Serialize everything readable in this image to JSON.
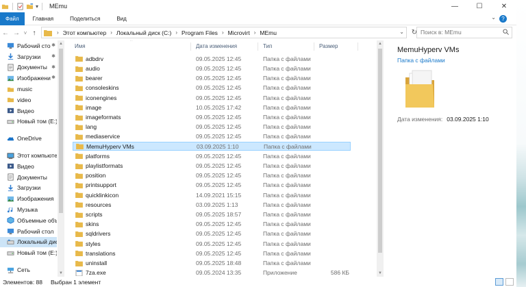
{
  "window": {
    "title": "MEmu",
    "controls": {
      "minimize": "—",
      "maximize": "☐",
      "close": "✕"
    }
  },
  "ribbon": {
    "tabs": [
      "Файл",
      "Главная",
      "Поделиться",
      "Вид"
    ]
  },
  "nav": {
    "back": "←",
    "forward": "→",
    "recent": "˅",
    "up": "↑"
  },
  "address": {
    "crumbs": [
      "Этот компьютер",
      "Локальный диск (C:)",
      "Program Files",
      "Microvirt",
      "MEmu"
    ]
  },
  "search": {
    "placeholder": "Поиск в: MEmu"
  },
  "sidebar": {
    "items": [
      {
        "label": "Рабочий сто",
        "icon": "desktop-icon",
        "pinned": true
      },
      {
        "label": "Загрузки",
        "icon": "downloads-icon",
        "pinned": true
      },
      {
        "label": "Документы",
        "icon": "documents-icon",
        "pinned": true
      },
      {
        "label": "Изображени",
        "icon": "pictures-icon",
        "pinned": true
      },
      {
        "label": "music",
        "icon": "folder-icon"
      },
      {
        "label": "video",
        "icon": "folder-icon"
      },
      {
        "label": "Видео",
        "icon": "videos-icon"
      },
      {
        "label": "Новый том (E:)",
        "icon": "drive-icon"
      },
      {
        "label": "OneDrive",
        "icon": "onedrive-icon",
        "gap": true
      },
      {
        "label": "Этот компьютер",
        "icon": "computer-icon",
        "gap": true
      },
      {
        "label": "Видео",
        "icon": "videos-icon"
      },
      {
        "label": "Документы",
        "icon": "documents-icon"
      },
      {
        "label": "Загрузки",
        "icon": "downloads-icon"
      },
      {
        "label": "Изображения",
        "icon": "pictures-icon"
      },
      {
        "label": "Музыка",
        "icon": "music-icon"
      },
      {
        "label": "Объемные объ",
        "icon": "3d-objects-icon"
      },
      {
        "label": "Рабочий стол",
        "icon": "desktop-icon"
      },
      {
        "label": "Локальный дис",
        "icon": "local-disk-icon",
        "selected": true
      },
      {
        "label": "Новый том (E:)",
        "icon": "drive-icon"
      },
      {
        "label": "Сеть",
        "icon": "network-icon",
        "gap": true
      }
    ]
  },
  "columns": {
    "name": "Имя",
    "date": "Дата изменения",
    "type": "Тип",
    "size": "Размер"
  },
  "files": [
    {
      "name": "adbdrv",
      "date": "09.05.2025 12:45",
      "type": "Папка с файлами",
      "size": ""
    },
    {
      "name": "audio",
      "date": "09.05.2025 12:45",
      "type": "Папка с файлами",
      "size": ""
    },
    {
      "name": "bearer",
      "date": "09.05.2025 12:45",
      "type": "Папка с файлами",
      "size": ""
    },
    {
      "name": "consoleskins",
      "date": "09.05.2025 12:45",
      "type": "Папка с файлами",
      "size": ""
    },
    {
      "name": "iconengines",
      "date": "09.05.2025 12:45",
      "type": "Папка с файлами",
      "size": ""
    },
    {
      "name": "image",
      "date": "10.05.2025 17:42",
      "type": "Папка с файлами",
      "size": ""
    },
    {
      "name": "imageformats",
      "date": "09.05.2025 12:45",
      "type": "Папка с файлами",
      "size": ""
    },
    {
      "name": "lang",
      "date": "09.05.2025 12:45",
      "type": "Папка с файлами",
      "size": ""
    },
    {
      "name": "mediaservice",
      "date": "09.05.2025 12:45",
      "type": "Папка с файлами",
      "size": ""
    },
    {
      "name": "MemuHyperv VMs",
      "date": "03.09.2025 1:10",
      "type": "Папка с файлами",
      "size": "",
      "selected": true
    },
    {
      "name": "platforms",
      "date": "09.05.2025 12:45",
      "type": "Папка с файлами",
      "size": ""
    },
    {
      "name": "playlistformats",
      "date": "09.05.2025 12:45",
      "type": "Папка с файлами",
      "size": ""
    },
    {
      "name": "position",
      "date": "09.05.2025 12:45",
      "type": "Папка с файлами",
      "size": ""
    },
    {
      "name": "printsupport",
      "date": "09.05.2025 12:45",
      "type": "Папка с файлами",
      "size": ""
    },
    {
      "name": "quicklinkicon",
      "date": "14.09.2021 15:15",
      "type": "Папка с файлами",
      "size": ""
    },
    {
      "name": "resources",
      "date": "03.09.2025 1:13",
      "type": "Папка с файлами",
      "size": ""
    },
    {
      "name": "scripts",
      "date": "09.05.2025 18:57",
      "type": "Папка с файлами",
      "size": ""
    },
    {
      "name": "skins",
      "date": "09.05.2025 12:45",
      "type": "Папка с файлами",
      "size": ""
    },
    {
      "name": "sqldrivers",
      "date": "09.05.2025 12:45",
      "type": "Папка с файлами",
      "size": ""
    },
    {
      "name": "styles",
      "date": "09.05.2025 12:45",
      "type": "Папка с файлами",
      "size": ""
    },
    {
      "name": "translations",
      "date": "09.05.2025 12:45",
      "type": "Папка с файлами",
      "size": ""
    },
    {
      "name": "uninstall",
      "date": "09.05.2025 18:48",
      "type": "Папка с файлами",
      "size": ""
    },
    {
      "name": "7za.exe",
      "date": "09.05.2024 13:35",
      "type": "Приложение",
      "size": "586 КБ",
      "exe": true
    }
  ],
  "preview": {
    "title": "MemuHyperv VMs",
    "subtitle": "Папка с файлами",
    "meta_label": "Дата изменения:",
    "meta_value": "03.09.2025 1:10"
  },
  "status": {
    "count": "Элементов: 88",
    "selected": "Выбран 1 элемент"
  },
  "colors": {
    "accent": "#1979ca",
    "selection": "#cce8ff",
    "folder": "#e8b94a"
  }
}
